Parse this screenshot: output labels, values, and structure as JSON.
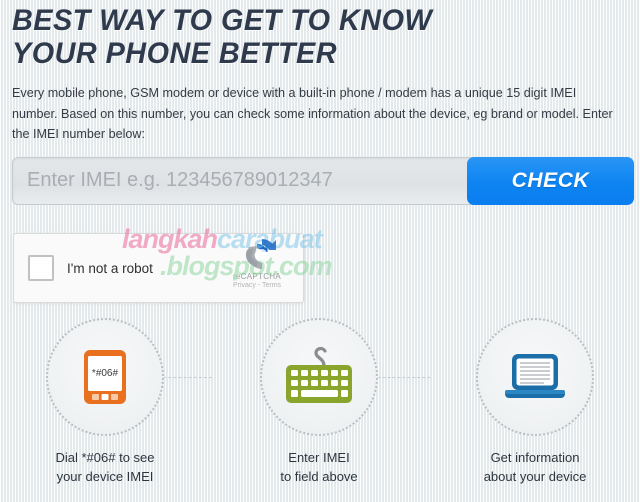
{
  "header": {
    "title_line1": "BEST WAY TO GET TO KNOW",
    "title_line2": "YOUR PHONE BETTER",
    "title_color": "#2f3a4d"
  },
  "intro": {
    "paragraph": "Every mobile phone, GSM modem or device with a built-in phone / modem has a unique 15 digit IMEI number. Based on this number, you can check some information about the device, eg brand or model. Enter the IMEI number below:"
  },
  "form": {
    "imei_placeholder": "Enter IMEI e.g. 123456789012347",
    "imei_value": "",
    "check_label": "CHECK",
    "check_color": "#0d84f2"
  },
  "recaptcha": {
    "checkbox_label": "I'm not a robot",
    "checked": false,
    "brand_name": "reCAPTCHA",
    "links": "Privacy - Terms",
    "logo_icon": "recaptcha-icon"
  },
  "watermark": {
    "part1": "langkah",
    "part2": "carabuat",
    "part3": ".blogspot.com",
    "full_text": "langkahcarabuat.blogspot.com"
  },
  "steps": [
    {
      "icon": "mobile-phone-icon",
      "icon_color": "#e8701f",
      "screen_text": "*#06#",
      "caption_line1": "Dial *#06# to see",
      "caption_line2": "your device IMEI"
    },
    {
      "icon": "keyboard-icon",
      "icon_color": "#8aa52c",
      "caption_line1": "Enter IMEI",
      "caption_line2": "to field above"
    },
    {
      "icon": "laptop-icon",
      "icon_color": "#1b6ea8",
      "caption_line1": "Get information",
      "caption_line2": "about your device"
    }
  ]
}
